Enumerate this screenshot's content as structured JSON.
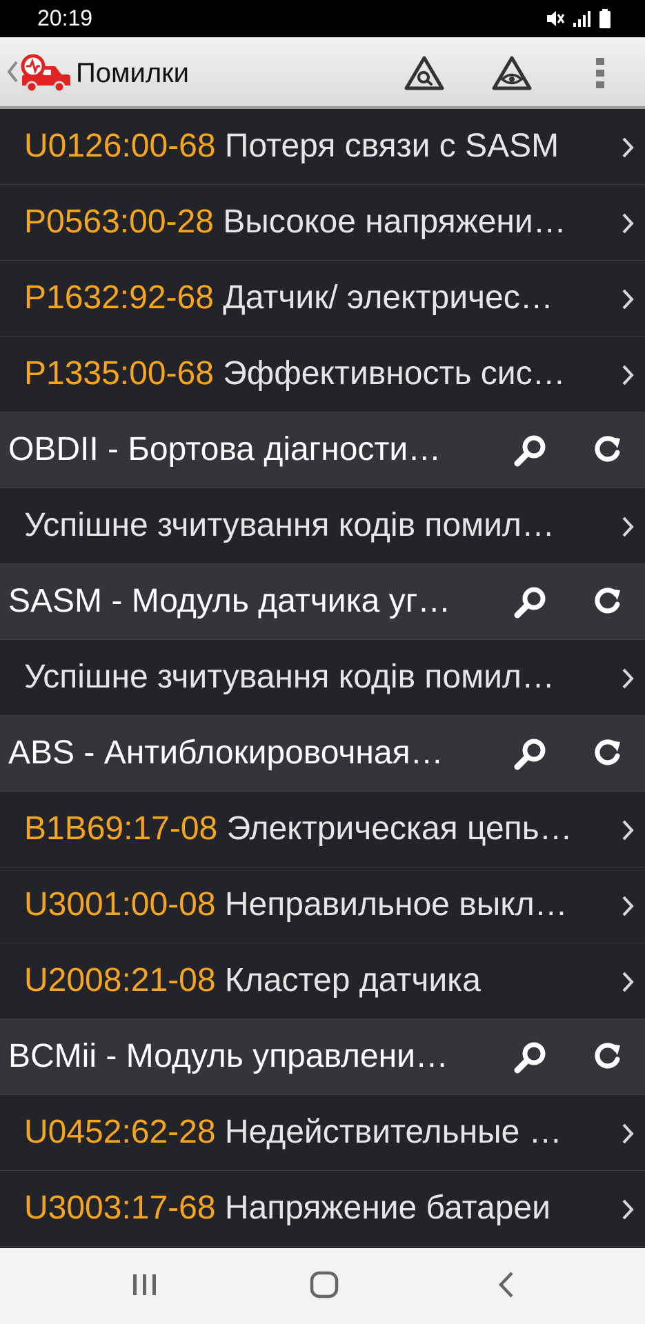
{
  "status_bar": {
    "time": "20:19",
    "icons": [
      "mute-icon",
      "signal-icon",
      "battery-icon"
    ]
  },
  "app_bar": {
    "title": "Помилки",
    "icons": [
      "back-chevron-icon",
      "car-diagnostic-logo-icon",
      "warning-search-icon",
      "warning-eye-icon",
      "more-vert-icon"
    ]
  },
  "colors": {
    "code": "#f7a51c",
    "row_bg": "#232429",
    "header_bg": "#34353b",
    "app_bar_bg": "#e6e6e6",
    "logo_red": "#e02424"
  },
  "rows": [
    {
      "type": "dtc",
      "code": "U0126:00-68",
      "text": "Потеря связи с SASM"
    },
    {
      "type": "dtc",
      "code": "P0563:00-28",
      "text": "Высокое напряжени…"
    },
    {
      "type": "dtc",
      "code": "P1632:92-68",
      "text": "Датчик/ электричес…"
    },
    {
      "type": "dtc",
      "code": "P1335:00-68",
      "text": "Эффективность сис…"
    },
    {
      "type": "module",
      "text": "OBDII - Бортова діагности…"
    },
    {
      "type": "message",
      "text": "Успішне зчитування кодів помил…"
    },
    {
      "type": "module",
      "text": "SASM - Модуль датчика уг…"
    },
    {
      "type": "message",
      "text": "Успішне зчитування кодів помил…"
    },
    {
      "type": "module",
      "text": "ABS - Антиблокировочная…"
    },
    {
      "type": "dtc",
      "code": "B1B69:17-08",
      "text": "Электрическая цепь…"
    },
    {
      "type": "dtc",
      "code": "U3001:00-08",
      "text": "Неправильное выкл…"
    },
    {
      "type": "dtc",
      "code": "U2008:21-08",
      "text": "Кластер датчика"
    },
    {
      "type": "module",
      "text": "BCMii - Модуль управлени…"
    },
    {
      "type": "dtc",
      "code": "U0452:62-28",
      "text": "Недействительные …"
    },
    {
      "type": "dtc",
      "code": "U3003:17-68",
      "text": "Напряжение батареи"
    }
  ],
  "nav_bar": {
    "icons": [
      "recent-apps-icon",
      "home-icon",
      "back-icon"
    ]
  }
}
